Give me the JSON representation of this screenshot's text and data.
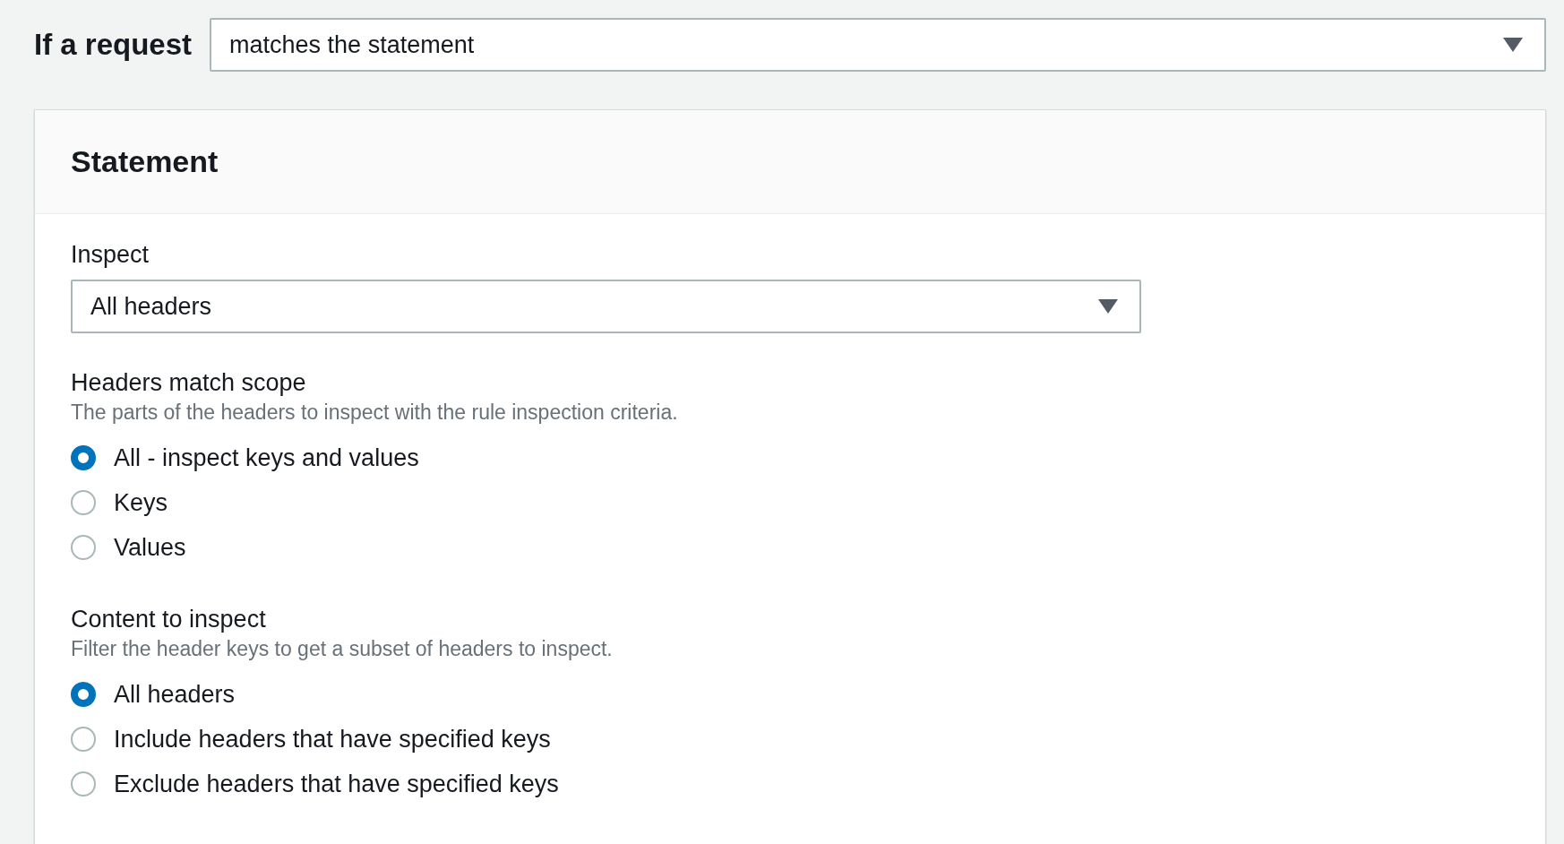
{
  "condition": {
    "label": "If a request",
    "value": "matches the statement"
  },
  "statement": {
    "title": "Statement",
    "inspect": {
      "label": "Inspect",
      "value": "All headers"
    },
    "groups": [
      {
        "label": "Headers match scope",
        "description": "The parts of the headers to inspect with the rule inspection criteria.",
        "options": [
          {
            "label": "All - inspect keys and values",
            "selected": true
          },
          {
            "label": "Keys",
            "selected": false
          },
          {
            "label": "Values",
            "selected": false
          }
        ]
      },
      {
        "label": "Content to inspect",
        "description": "Filter the header keys to get a subset of headers to inspect.",
        "options": [
          {
            "label": "All headers",
            "selected": true
          },
          {
            "label": "Include headers that have specified keys",
            "selected": false
          },
          {
            "label": "Exclude headers that have specified keys",
            "selected": false
          }
        ]
      }
    ]
  }
}
